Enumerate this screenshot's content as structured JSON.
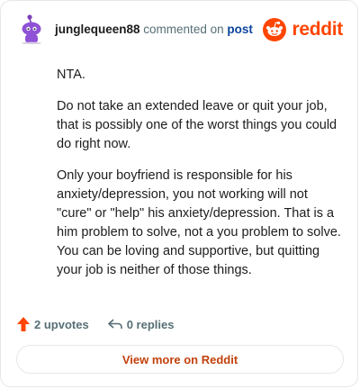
{
  "header": {
    "username": "junglequeen88",
    "action_text": "commented on",
    "post_link": "post",
    "brand_name": "reddit"
  },
  "comment": {
    "paragraphs": [
      "NTA.",
      "Do not take an extended leave or quit your job, that is possibly one of the worst things you could do right now.",
      "Only your boyfriend is responsible for his anxiety/depression, you not working will not \"cure\" or \"help\" his anxiety/depression. That is a him problem to solve, not a you problem to solve. You can be loving and supportive, but quitting your job is neither of those things."
    ]
  },
  "actions": {
    "upvotes": "2 upvotes",
    "replies": "0 replies"
  },
  "footer": {
    "view_more_label": "View more on Reddit"
  },
  "colors": {
    "brand": "#ff4500",
    "link": "#0a449b",
    "muted": "#576f76",
    "view_more_text": "#c2410c"
  },
  "icons": {
    "avatar": "snoo-avatar-icon",
    "logo": "reddit-snoo-icon",
    "upvote": "upvote-arrow-icon",
    "reply": "reply-arrow-icon"
  }
}
